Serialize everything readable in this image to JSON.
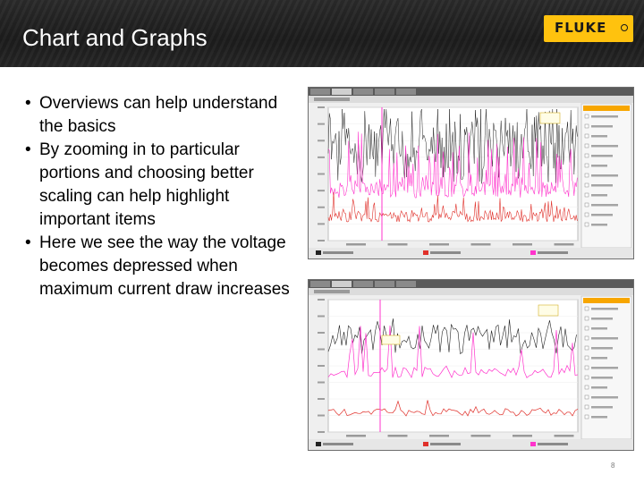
{
  "slide": {
    "title": "Chart and Graphs",
    "logo_text": "FLUKE",
    "logo_mark": "®",
    "page_number": "8"
  },
  "bullets": [
    "Overviews can help understand the basics",
    "By zooming in to particular portions and choosing better scaling can help highlight important items",
    "Here we see the way the voltage becomes depressed when maximum current draw increases"
  ],
  "screenshots": [
    {
      "name": "overview-chart-screenshot",
      "accent": "#ff33cc"
    },
    {
      "name": "zoomed-chart-screenshot",
      "accent": "#ff33cc"
    }
  ],
  "colors": {
    "voltage": "#222222",
    "current_max": "#ff33cc",
    "current_min": "#e0302a",
    "accent_panel": "#f7a600"
  }
}
